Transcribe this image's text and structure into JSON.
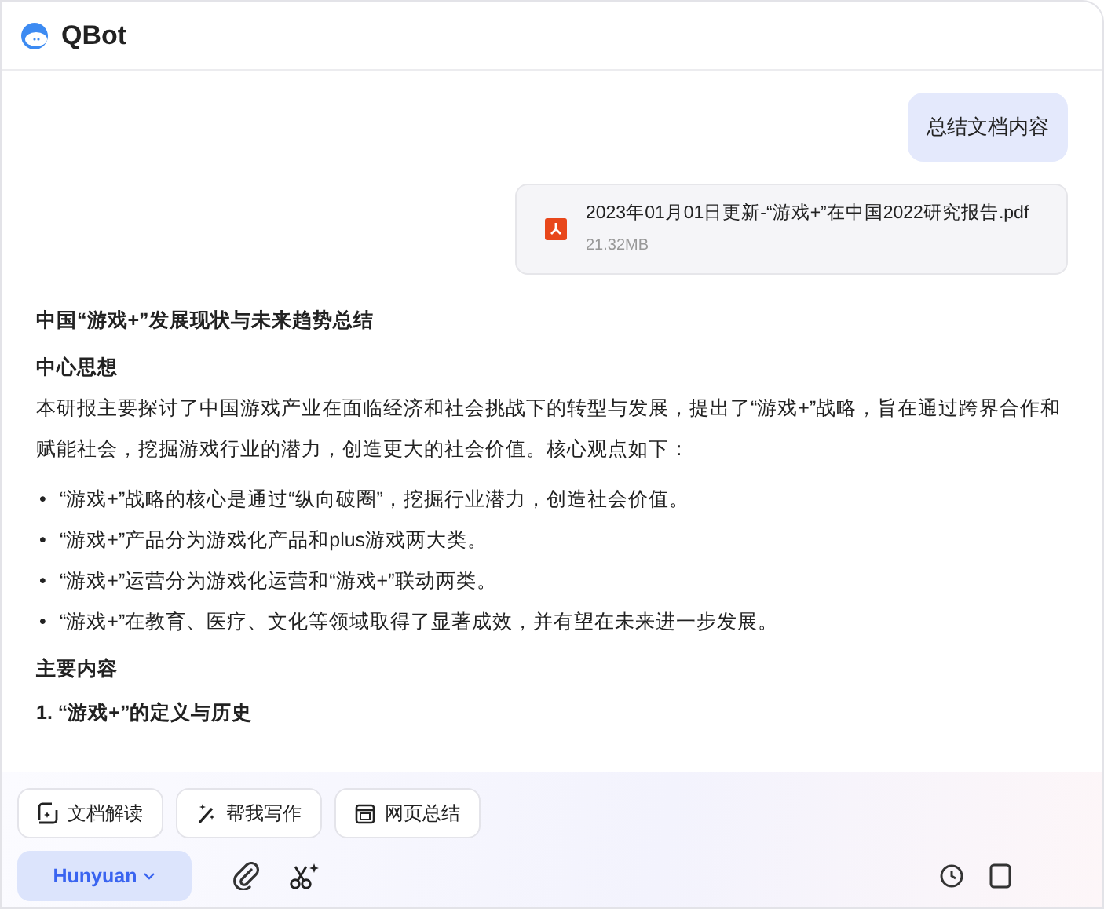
{
  "app": {
    "title": "QBot"
  },
  "messages": [
    {
      "kind": "user_text",
      "text": "总结文档内容"
    },
    {
      "kind": "file",
      "name": "2023年01月01日更新-“游戏+”在中国2022研究报告.pdf",
      "size": "21.32MB"
    },
    {
      "kind": "answer",
      "blocks": [
        {
          "kind": "title",
          "text": "中国“游戏+”发展现状与未来趋势总结"
        },
        {
          "kind": "heading",
          "text": "中心思想"
        },
        {
          "kind": "paragraph",
          "text": "本研报主要探讨了中国游戏产业在面临经济和社会挑战下的转型与发展，提出了“游戏+”战略，旨在通过跨界合作和赋能社会，挖掘游戏行业的潜力，创造更大的社会价值。核心观点如下："
        },
        {
          "kind": "list",
          "marker": "•",
          "items": [
            "“游戏+”战略的核心是通过“纵向破圈”，挖掘行业潜力，创造社会价值。",
            "“游戏+”产品分为游戏化产品和plus游戏两大类。",
            "“游戏+”运营分为游戏化运营和“游戏+”联动两类。",
            "“游戏+”在教育、医疗、文化等领域取得了显著成效，并有望在未来进一步发展。"
          ]
        },
        {
          "kind": "heading",
          "text": "主要内容"
        },
        {
          "kind": "heading",
          "text": "1. “游戏+”的定义与历史"
        }
      ]
    }
  ],
  "quick_actions": [
    {
      "label": "文档解读"
    },
    {
      "label": "帮我写作"
    },
    {
      "label": "网页总结"
    }
  ],
  "model_selector": {
    "label": "Hunyuan"
  }
}
